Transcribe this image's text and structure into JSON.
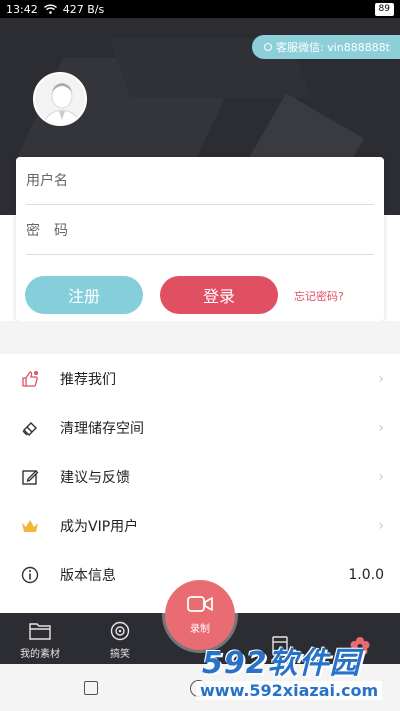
{
  "status_bar": {
    "time": "13:42",
    "network_speed": "427 B/s",
    "battery": "89"
  },
  "header": {
    "wechat_contact": "客服微信: vin888888t"
  },
  "login": {
    "username_placeholder": "用户名",
    "password_placeholder": "密　码",
    "register_label": "注册",
    "login_label": "登录",
    "forgot_label": "忘记密码?"
  },
  "menu": {
    "items": [
      {
        "label": "推荐我们",
        "icon": "thumbs-up-icon"
      },
      {
        "label": "清理储存空间",
        "icon": "eraser-icon"
      },
      {
        "label": "建议与反馈",
        "icon": "edit-icon"
      },
      {
        "label": "成为VIP用户",
        "icon": "crown-icon"
      },
      {
        "label": "版本信息",
        "icon": "info-icon",
        "value": "1.0.0"
      }
    ]
  },
  "tabbar": {
    "tabs": [
      {
        "label": "我的素材",
        "icon": "folder-icon"
      },
      {
        "label": "搞笑",
        "icon": "eye-icon"
      },
      {
        "label": "录制",
        "icon": "video-camera-icon"
      },
      {
        "label": "",
        "icon": "bookmark-icon"
      },
      {
        "label": "",
        "icon": "flower-icon"
      }
    ]
  },
  "watermark": {
    "brand": "592软件园",
    "url": "www.592xiazai.com"
  },
  "colors": {
    "header_bg": "#2c2d33",
    "register": "#85cfda",
    "login": "#e14f62",
    "record": "#e86c72",
    "active_tab": "#e86c72"
  }
}
